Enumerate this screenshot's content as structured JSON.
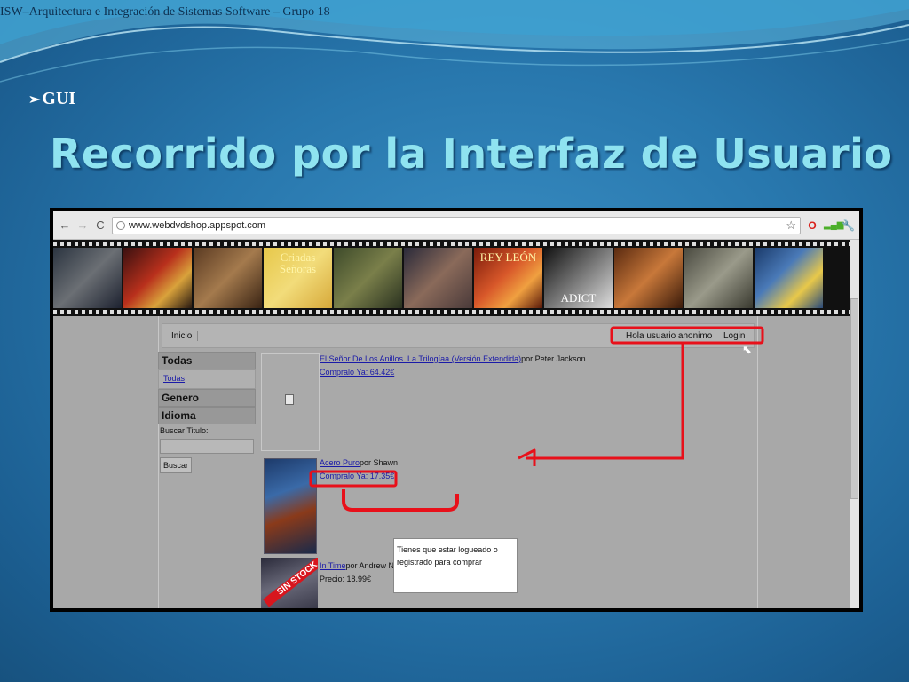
{
  "slide": {
    "header_text": "ISW–Arquitectura e Integración de Sistemas Software – Grupo 18",
    "bullet": "GUI",
    "title": "Recorrido por la Interfaz de Usuario"
  },
  "browser": {
    "url": "www.webdvdshop.appspot.com",
    "icons": [
      "back-icon",
      "forward-icon",
      "reload-icon",
      "star-icon",
      "opera-icon",
      "signal-bars-icon",
      "wrench-icon"
    ]
  },
  "banner": {
    "frames": [
      "",
      "",
      "",
      "Criadas Señoras",
      "",
      "",
      "REY LEÓN",
      "ADICT",
      "",
      "",
      ""
    ]
  },
  "site": {
    "nav": {
      "inicio": "Inicio",
      "greeting": "Hola usuario anonimo",
      "login": "Login"
    },
    "sidebar": {
      "todas_head": "Todas",
      "todas_link": "Todas",
      "genero_head": "Genero",
      "idioma_head": "Idioma",
      "search_label": "Buscar Titulo:",
      "search_button": "Buscar"
    },
    "products": [
      {
        "title": "El Señor De Los Anillos. La Trilogíaa (Versión Extendida)",
        "author": "por Peter Jackson",
        "price_line": "Compralo Ya: 64.42€"
      },
      {
        "title": "Acero Puro",
        "author": "por Shawn",
        "price_line": "Compralo Ya: 17.35€"
      },
      {
        "title": "In Time",
        "author": "por Andrew Niccol",
        "price_line": "Precio: 18.99€",
        "stock_badge": "SIN STOCK"
      }
    ],
    "tooltip": "Tienes que estar logueado o registrado para comprar"
  },
  "annotations": {
    "highlight_color": "#e8101a"
  }
}
